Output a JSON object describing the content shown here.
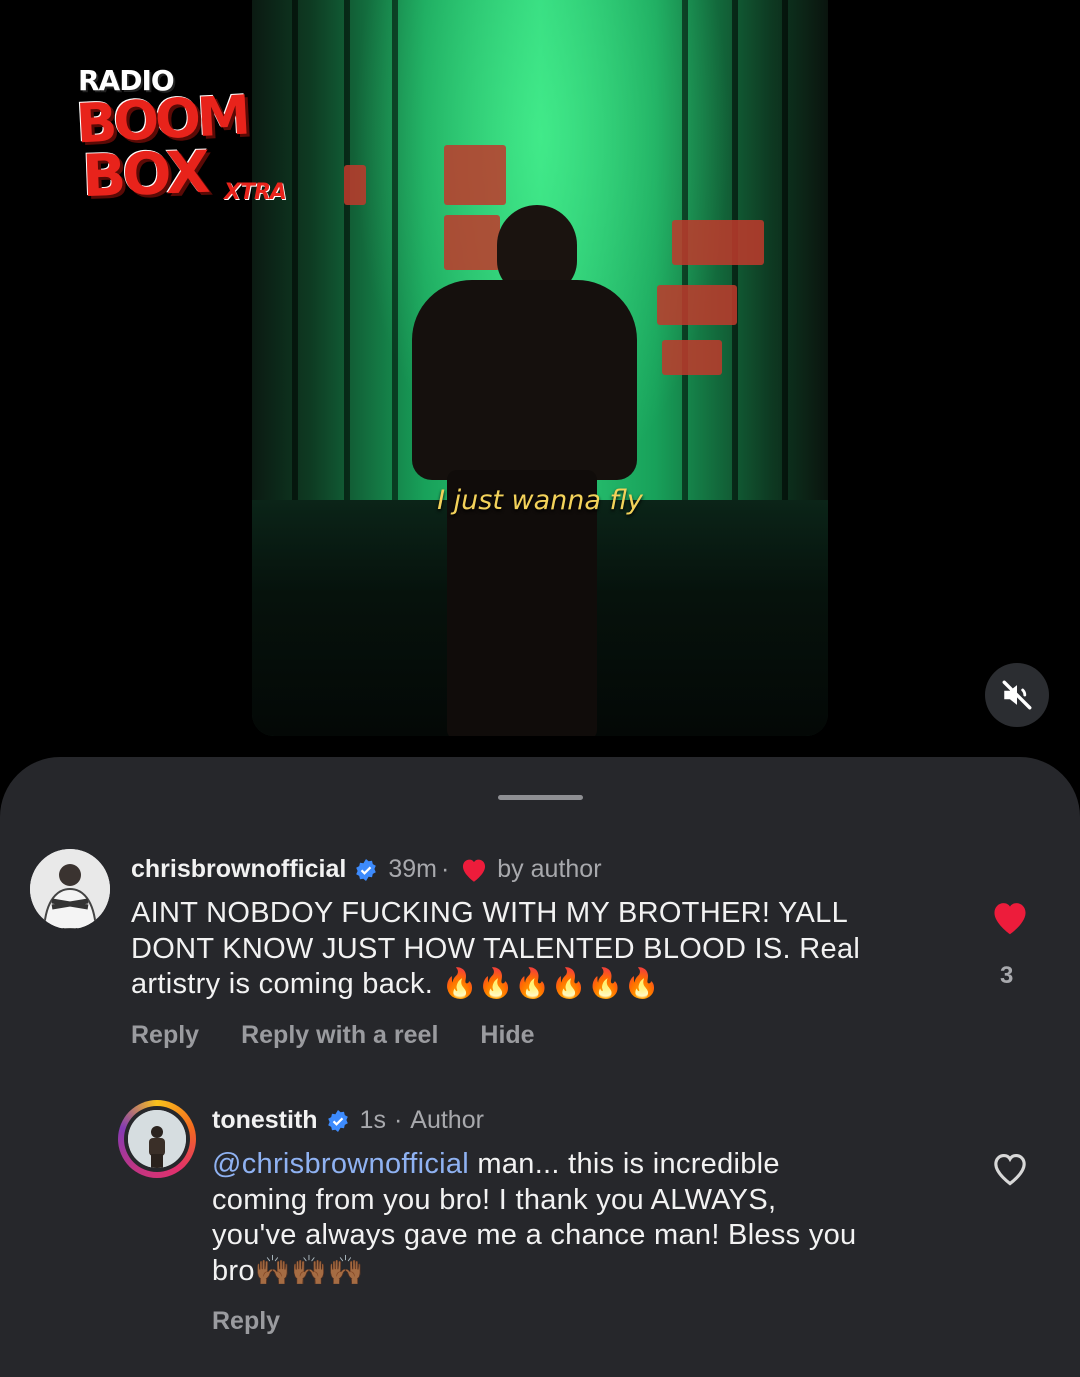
{
  "video": {
    "subtitle": "I just wanna fly"
  },
  "logo": {
    "line1": "RADIO",
    "line2": "BOOM",
    "line3": "BOX",
    "line4": "XTRA"
  },
  "controls": {
    "mute_icon": "speaker-muted-icon"
  },
  "comments": [
    {
      "username": "chrisbrownofficial",
      "verified": true,
      "time": "39m",
      "separator": "·",
      "liked_by_author_text": "by author",
      "text_lines": [
        "AINT NOBDOY FUCKING WITH MY BROTHER! YALL",
        "DONT KNOW JUST HOW TALENTED BLOOD IS. Real",
        "artistry is coming back. 🔥🔥🔥🔥🔥🔥"
      ],
      "actions": [
        "Reply",
        "Reply with a reel",
        "Hide"
      ],
      "liked": true,
      "like_count": "3"
    },
    {
      "username": "tonestith",
      "verified": true,
      "time": "1s",
      "separator": "·",
      "role": "Author",
      "mention": "@chrisbrownofficial",
      "text_line1_rest": " man... this is incredible",
      "text_lines": [
        "coming from you bro! I thank you ALWAYS,",
        "you've always gave me a chance man! Bless you",
        "bro🙌🏾🙌🏾🙌🏾"
      ],
      "actions": [
        "Reply"
      ],
      "liked": false
    }
  ],
  "colors": {
    "sheet_bg": "#26272b",
    "like_red": "#ed1c3b",
    "verified_blue": "#3d8bfd",
    "mention_blue": "#8fb2f2"
  }
}
